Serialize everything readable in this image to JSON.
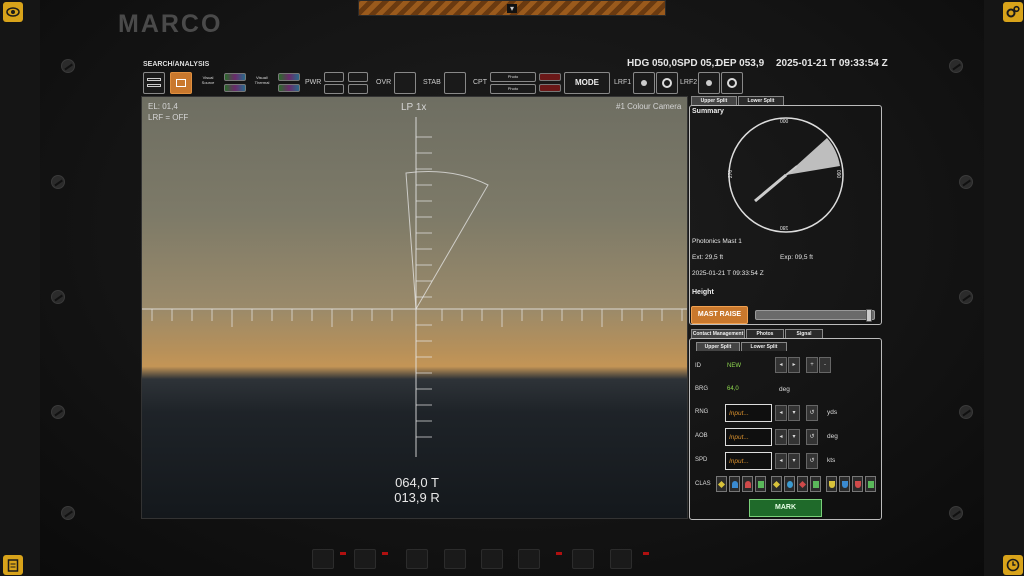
{
  "app": {
    "logo": "MARCO"
  },
  "toolbar": {
    "title": "SEARCH/ANALYSIS",
    "visual_source": "Visual\nSource",
    "visual_thermal": "Visual/\nThermal",
    "pwr": "PWR",
    "ovr": "OVR",
    "stab": "STAB",
    "cpt": "CPT",
    "photo1": "Photo",
    "photo2": "Photo",
    "mode": "MODE",
    "lrf1": "LRF1",
    "lrf2": "LRF2"
  },
  "status": {
    "hdg": "HDG 050,0",
    "spd": "SPD 05,1",
    "dep": "DEP 053,9",
    "datetime": "2025-01-21 T 09:33:54 Z"
  },
  "camera": {
    "el": "EL: 01,4",
    "lrf": "LRF = OFF",
    "lens": "LP 1x",
    "source": "#1 Colour Camera",
    "true_bearing": "064,0 T",
    "relative_bearing": "013,9 R"
  },
  "summary_panel": {
    "tabs": [
      "Upper Split",
      "Lower Split"
    ],
    "title": "Summary",
    "compass": {
      "top": "000",
      "right": "090",
      "bottom": "180",
      "left": "270"
    },
    "mast_name": "Photonics Mast 1",
    "ext": "Ext: 29,5 ft",
    "exp": "Exp: 09,5 ft",
    "datetime": "2025-01-21 T 09:33:54 Z",
    "height_label": "Height",
    "mast_raise": "MAST RAISE",
    "height_fraction": 0.98
  },
  "contact_panel": {
    "tabs": [
      "Contact Management",
      "Photos",
      "Signal"
    ],
    "subtabs": [
      "Upper Split",
      "Lower Split"
    ],
    "id_label": "ID",
    "id_value": "NEW",
    "brg_label": "BRG",
    "brg_value": "64,0",
    "brg_unit": "deg",
    "rng_label": "RNG",
    "rng_placeholder": "Input...",
    "rng_unit": "yds",
    "aob_label": "AOB",
    "aob_placeholder": "Input...",
    "aob_unit": "deg",
    "spd_label": "SPD",
    "spd_placeholder": "Input...",
    "spd_unit": "kts",
    "clas_label": "CLAS",
    "mark": "MARK"
  },
  "colors": {
    "accent_orange": "#c9782d",
    "brand_yellow": "#d8a31a",
    "ok_green": "#8fd94f",
    "mark_green": "#1f6a2a"
  },
  "icons": {
    "top_left": "eye-icon",
    "top_right": "gears-icon",
    "bottom_left": "clipboard-icon",
    "bottom_right": "clock-icon"
  }
}
